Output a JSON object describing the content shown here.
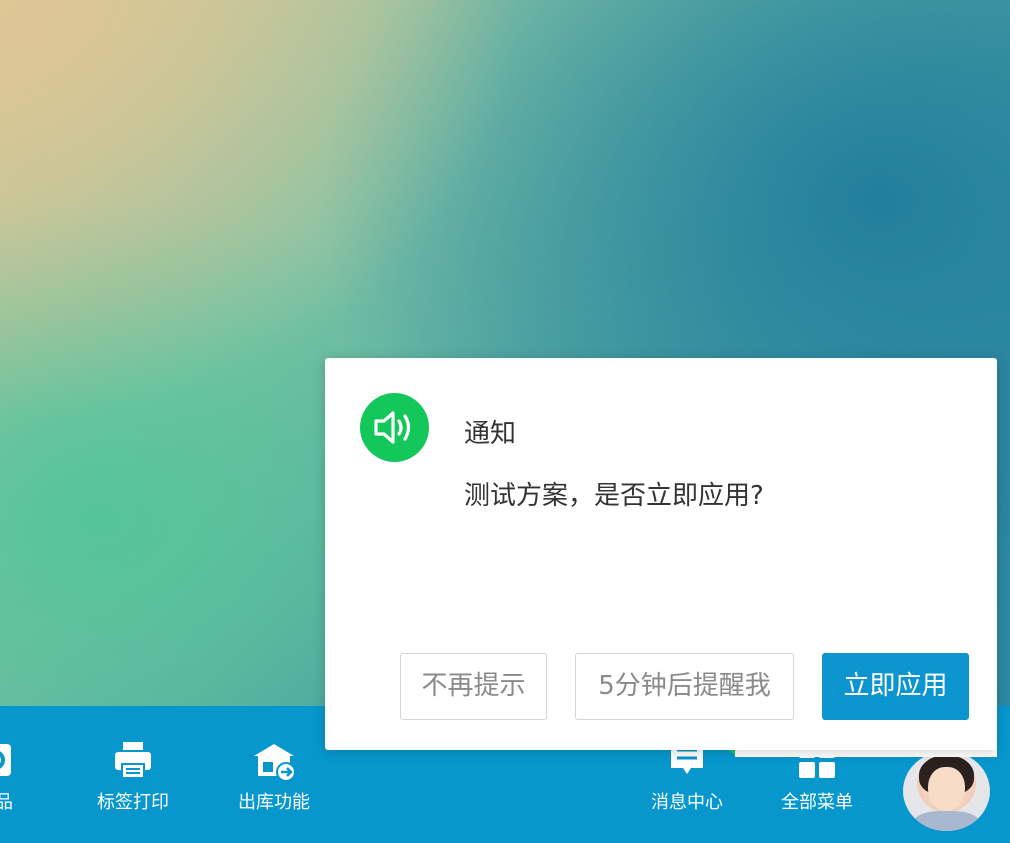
{
  "dialog": {
    "title": "通知",
    "message": "测试方案，是否立即应用?",
    "buttons": {
      "dismiss": "不再提示",
      "snooze": "5分钟后提醒我",
      "apply": "立即应用"
    },
    "icon": "speaker-icon",
    "accent_color": "#0d95cf",
    "icon_color": "#14c75a"
  },
  "taskbar": {
    "color": "#0797cd",
    "items": [
      {
        "label": "商品",
        "icon": "product-icon"
      },
      {
        "label": "标签打印",
        "icon": "printer-icon"
      },
      {
        "label": "出库功能",
        "icon": "warehouse-out-icon"
      },
      {
        "label": "消息中心",
        "icon": "message-icon"
      },
      {
        "label": "全部菜单",
        "icon": "grid-menu-icon"
      }
    ],
    "avatar": "customer-service-avatar"
  }
}
